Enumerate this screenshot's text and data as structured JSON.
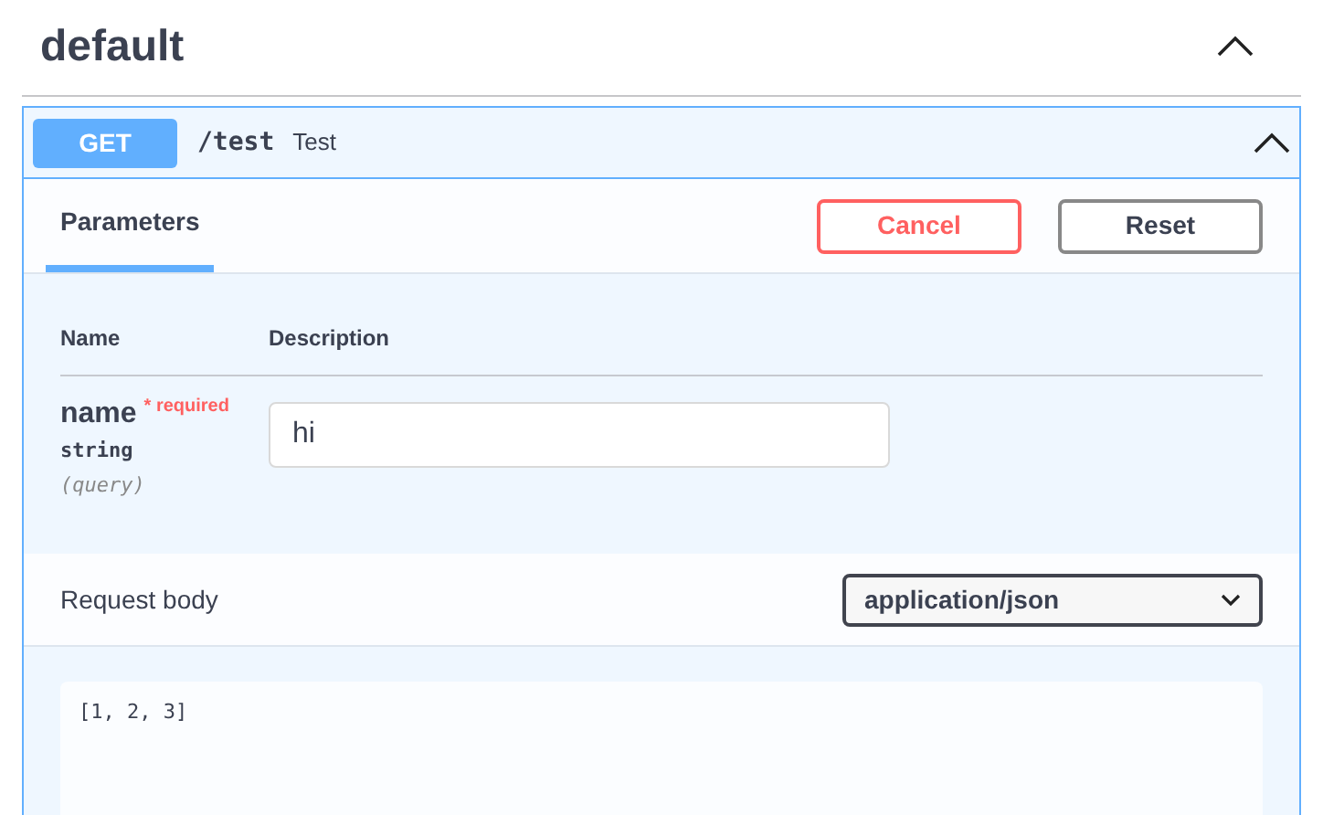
{
  "section": {
    "title": "default",
    "expanded": true
  },
  "operation": {
    "method": "GET",
    "path": "/test",
    "summary": "Test",
    "expanded": true
  },
  "tabs": [
    {
      "label": "Parameters",
      "selected": true
    }
  ],
  "actions": [
    {
      "label": "Cancel",
      "kind": "cancel"
    },
    {
      "label": "Reset",
      "kind": "reset"
    }
  ],
  "parameters": {
    "columns": [
      "Name",
      "Description"
    ],
    "rows": [
      {
        "name": "name",
        "required_mark": "*",
        "required_label": "required",
        "type": "string",
        "location": "(query)",
        "value": "hi"
      }
    ]
  },
  "request_body": {
    "label": "Request body",
    "content_type": "application/json",
    "value": "[1, 2, 3]"
  }
}
